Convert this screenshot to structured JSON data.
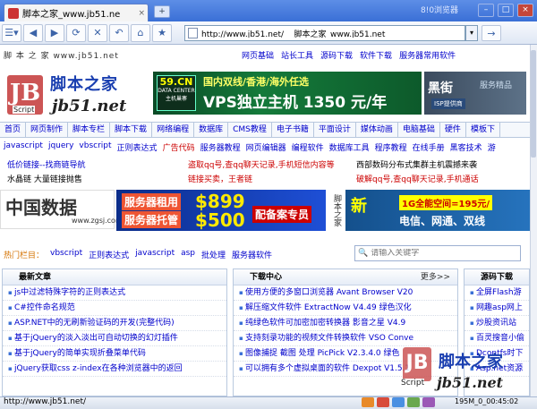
{
  "browser": {
    "tab_title": "脚本之家_www.jb51.ne",
    "tab_close": "×",
    "newtab": "+",
    "app_name": "8!0浏览器",
    "url": "http://www.jb51.net/    脚本之家_www.jb51.net",
    "go_label": "→"
  },
  "site": {
    "top_text": "脚 本 之 家  www.jb51.net",
    "top_links": [
      "网页基础",
      "站长工具",
      "源码下载",
      "软件下载",
      "服务器常用软件"
    ],
    "logo_cn": "脚本之家",
    "logo_en": "jb51.net",
    "logo_script": "Script",
    "banner1": {
      "badge": "59.CN",
      "badge_sub": "DATA CENTER",
      "badge_sub2": "主机巢寨",
      "line1": "国内双线/香港/海外任选",
      "line2": "VPS独立主机 1350 元/年"
    },
    "banner2": {
      "text1": "黑街",
      "text2": "ISP提供商",
      "text3": "服务精品"
    },
    "nav": [
      "首页",
      "网页制作",
      "脚本专栏",
      "脚本下载",
      "网络编程",
      "数据库",
      "CMS教程",
      "电子书籍",
      "平面设计",
      "媒体动画",
      "电脑基础",
      "硬件",
      "模板下"
    ],
    "subnav": [
      "javascript",
      "jquery",
      "vbscript",
      "正则表达式",
      "广告代码",
      "服务器教程",
      "网页编辑器",
      "编程软件",
      "数据库工具",
      "程序教程",
      "在线手册",
      "黑客技术",
      "游"
    ],
    "row1": [
      "低价链接--找商链导航",
      "盗取qq号,查qq聊天记录,手机短信内容等",
      "西部数码分布式集群主机震撼来袭"
    ],
    "row2": [
      "水晶链  大量链接抛售",
      "链接买卖，王者链",
      "破解qq号,查qq聊天记录,手机通话"
    ],
    "banner3": {
      "zg_cn": "中国数据",
      "zg_url": "www.zgsj.com",
      "b3a": "服务器租用",
      "b3b": "服务器托管",
      "b3c": "$899",
      "b3d": "$500",
      "b3e": "配备案专员"
    },
    "vert": "脚本之家",
    "banner4": {
      "t1": "1G全能空间=195元/",
      "t2": "电信、网通、双线",
      "logo": "新"
    },
    "hot_label": "热门栏目：",
    "hot_links": [
      "vbscript",
      "正则表达式",
      "javascript",
      "asp",
      "批处理",
      "服务器软件"
    ],
    "search_placeholder": "请输入关键字",
    "box1": {
      "title": "最新文章",
      "items": [
        "js中过滤特殊字符的正则表达式",
        "C#控件命名规范",
        "ASP.NET中的无刷新验证码的开发(完整代码)",
        "基于jQuery的淡入淡出可自动切换的幻灯插件",
        "基于jQuery的简单实现折叠菜单代码",
        "jQuery获取css z-index在各种浏览器中的返回"
      ]
    },
    "box2": {
      "title": "下载中心",
      "more": "更多>>",
      "items": [
        "使用方便的多窗口浏览器  Avant Browser V20",
        "解压缩文件软件  ExtractNow V4.49 绿色汉化",
        "纯绿色软件可加密加密转换器  影音之星 V4.9",
        "支持刻录功能的视频文件转换软件  VSO Conve",
        "图像捕捉  截图  处理  PicPick V2.3.4.0 绿色",
        "可以拥有多个虚拟桌面的软件  Dexpot V1.5.1"
      ]
    },
    "box3": {
      "title": "源码下载",
      "items": [
        "全屏Flash游",
        "网趣asp网上",
        "炒股资讯站",
        "百灵搜音小偷",
        "Dcontfs时下",
        "Asp.net资源"
      ]
    },
    "watermark": {
      "cn": "脚本之家",
      "en": "jb51.net",
      "script": "Script"
    }
  },
  "status": {
    "url": "http://www.jb51.net/",
    "mem": "195M_0_00:45:02"
  }
}
